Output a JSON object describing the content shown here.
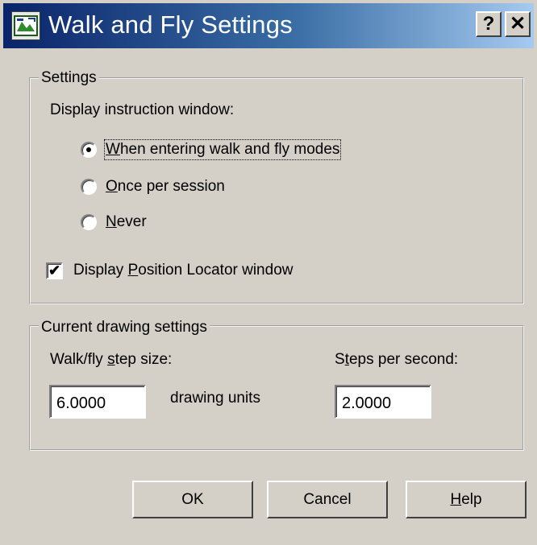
{
  "window": {
    "title": "Walk and Fly Settings",
    "help_button": "?",
    "close_button": "✕"
  },
  "settings": {
    "legend": "Settings",
    "instruction_label": "Display instruction window:",
    "radios": [
      {
        "key": "W",
        "rest": "hen entering walk and fly modes",
        "selected": true
      },
      {
        "key": "O",
        "rest": "nce per session",
        "selected": false
      },
      {
        "key": "N",
        "rest": "ever",
        "selected": false
      }
    ],
    "locator": {
      "pre": "Display ",
      "key": "P",
      "rest": "osition Locator window",
      "checked": true
    }
  },
  "drawing": {
    "legend": "Current drawing settings",
    "step_size_pre": "Walk/fly ",
    "step_size_key": "s",
    "step_size_rest": "tep size:",
    "step_size_value": "6.0000",
    "units_label": "drawing units",
    "steps_per_sec_pre": "S",
    "steps_per_sec_key": "t",
    "steps_per_sec_rest": "eps per second:",
    "steps_per_sec_value": "2.0000"
  },
  "buttons": {
    "ok": "OK",
    "cancel": "Cancel",
    "help_key": "H",
    "help_rest": "elp"
  }
}
